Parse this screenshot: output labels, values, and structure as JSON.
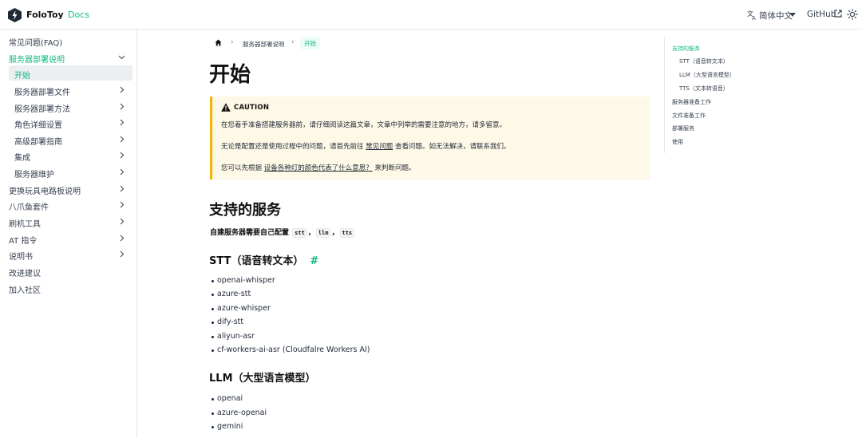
{
  "header": {
    "brand": "FoloToy",
    "docs": "Docs",
    "language": "简体中文",
    "github": "GitHub",
    "icons": [
      "logo-icon",
      "translate-icon",
      "caret-down-icon",
      "external-link-icon",
      "sun-icon"
    ]
  },
  "sidebar": {
    "items": [
      {
        "label": "常见问题(FAQ)"
      },
      {
        "label": "服务器部署说明"
      },
      {
        "label": "开始"
      },
      {
        "label": "服务器部署文件"
      },
      {
        "label": "服务器部署方法"
      },
      {
        "label": "角色详细设置"
      },
      {
        "label": "高级部署指南"
      },
      {
        "label": "集成"
      },
      {
        "label": "服务器维护"
      },
      {
        "label": "更换玩具电路板说明"
      },
      {
        "label": "八爪鱼套件"
      },
      {
        "label": "刷机工具"
      },
      {
        "label": "AT 指令"
      },
      {
        "label": "说明书"
      },
      {
        "label": "改进建议"
      },
      {
        "label": "加入社区"
      }
    ]
  },
  "breadcrumb": {
    "sep": "›",
    "items": [
      "服务器部署说明",
      "开始"
    ]
  },
  "main": {
    "title": "开始",
    "caution": {
      "title": "CAUTION",
      "p1": "在您着手准备搭建服务器前，请仔细阅读这篇文章，文章中列举的需要注意的地方，请多留意。",
      "p2_a": "无论是配置还是使用过程中的问题，请首先前往",
      "p2_link": "常见问题",
      "p2_b": "查看问题。如无法解决，请联系我们。",
      "p3_a": "您可以先根据",
      "p3_link": "设备各种灯的颜色代表了什么意思？",
      "p3_b": "来判断问题。"
    },
    "section_title": "支持的服务",
    "intro": "自建服务器需要自己配置",
    "codes": [
      "stt",
      "llm",
      "tts"
    ],
    "comma": "，",
    "stt": {
      "title": "STT（语音转文本）",
      "anchor": "#",
      "items": [
        "openai-whisper",
        "azure-stt",
        "azure-whisper",
        "dify-stt",
        "aliyun-asr",
        "cf-workers-ai-asr (Cloudfalre Workers AI)"
      ]
    },
    "llm": {
      "title": "LLM（大型语言模型）",
      "items": [
        "openai",
        "azure-openai",
        "gemini"
      ]
    }
  },
  "toc": {
    "items": [
      "支持的服务",
      "STT（语音转文本）",
      "LLM（大型语言模型）",
      "TTS（文本转语音）",
      "服务器准备工作",
      "文件准备工作",
      "部署服务",
      "使用"
    ]
  },
  "colors": {
    "accent": "#10b981",
    "caution_bg": "#fef8e7",
    "caution_border": "#f1b400"
  }
}
